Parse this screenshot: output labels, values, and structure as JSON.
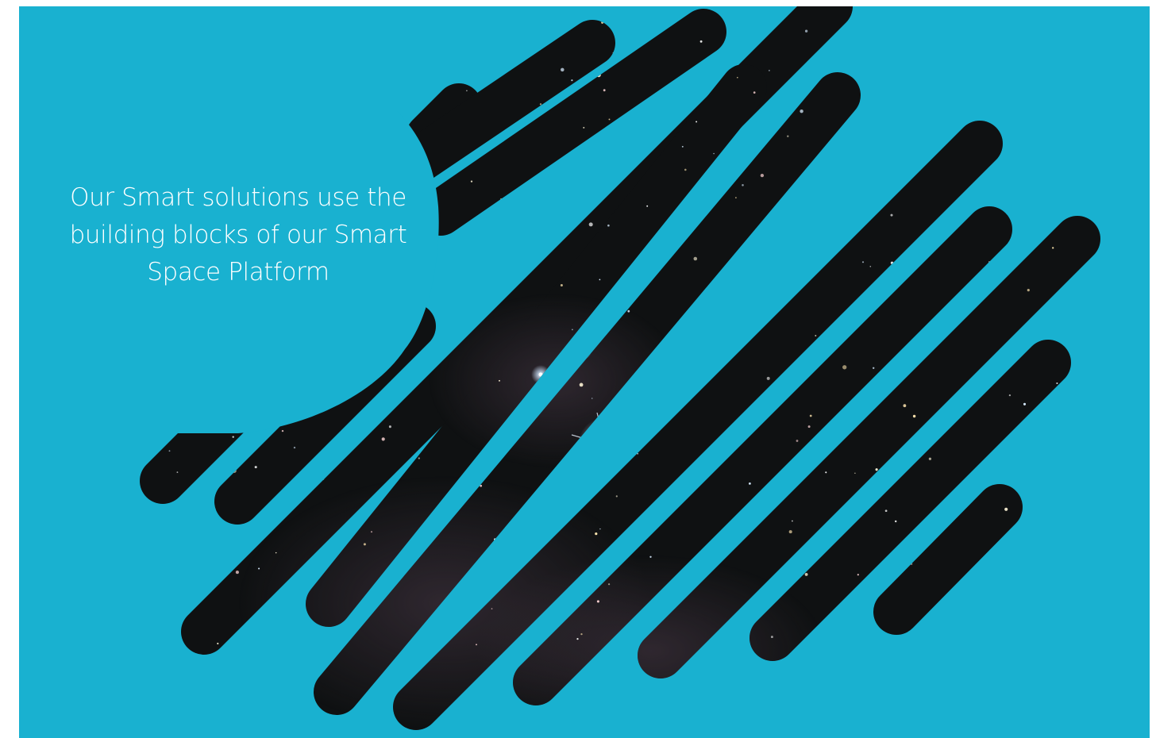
{
  "panel": {
    "background_color": "#19b1d0",
    "text_color": "#ffffff",
    "stripe_color": "#0f1112"
  },
  "tagline": {
    "line1": "Our Smart solutions use the",
    "line2": "building blocks of our Smart",
    "line3": "Space Platform"
  },
  "artwork": {
    "description_icon": "night-sky-stripes-graphic"
  }
}
